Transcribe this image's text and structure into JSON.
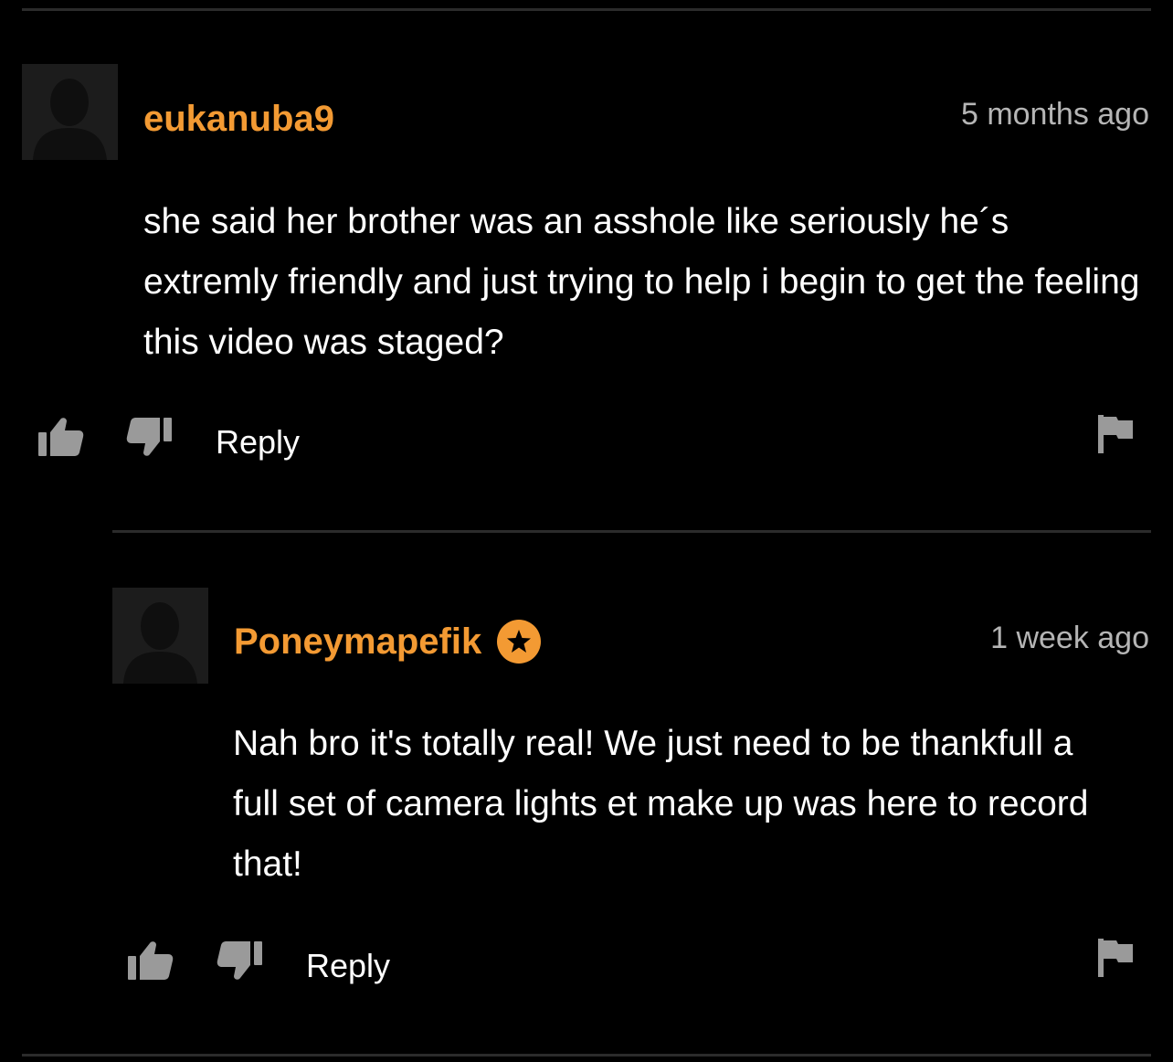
{
  "comments": [
    {
      "username": "eukanuba9",
      "time": "5 months ago",
      "text": "she said her brother was an asshole like seriously he´s extremly friendly and just trying to help i begin to get the feeling this video was staged?",
      "reply_label": "Reply",
      "verified": false
    },
    {
      "username": "Poneymapefik",
      "time": "1 week ago",
      "text": "Nah bro it's totally real! We just need to be thankfull a full set of camera lights et make up was here to record that!",
      "reply_label": "Reply",
      "verified": true
    }
  ],
  "icons": {
    "avatar": "user-silhouette-icon",
    "like": "thumbs-up-icon",
    "dislike": "thumbs-down-icon",
    "flag": "flag-icon",
    "badge": "star-badge-icon"
  },
  "colors": {
    "background": "#000000",
    "username": "#f39a33",
    "timestamp": "#b5b5b5",
    "icon": "#9a9a9a",
    "divider": "#2b2b2b"
  }
}
